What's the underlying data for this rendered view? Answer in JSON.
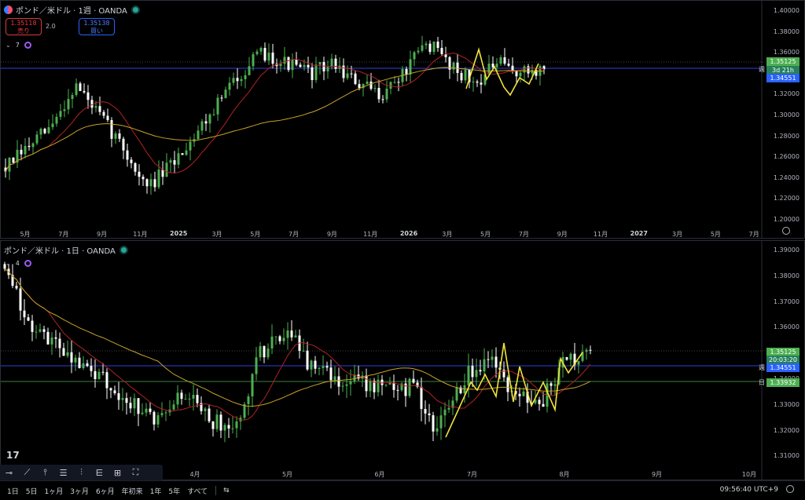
{
  "top_chart": {
    "symbol": "ポンド／米ドル · 1週 · OANDA",
    "sell_price": "1.35118",
    "sell_label": "売り",
    "spread": "2.0",
    "buy_price": "1.35138",
    "buy_label": "買い",
    "indicator_count": "7",
    "y_ticks": [
      "1.40000",
      "1.38000",
      "1.36000",
      "1.34000",
      "1.32000",
      "1.30000",
      "1.28000",
      "1.26000",
      "1.24000",
      "1.22000",
      "1.20000"
    ],
    "x_ticks": [
      "5月",
      "7月",
      "9月",
      "11月",
      "2025",
      "3月",
      "5月",
      "7月",
      "9月",
      "11月",
      "2026",
      "3月",
      "5月",
      "7月",
      "9月",
      "11月",
      "2027",
      "3月",
      "5月",
      "7月"
    ],
    "last_price_tag": "1.35125",
    "countdown_tag": "3d 21h",
    "weekly_level_tag": "1.34551",
    "weekly_level_label": "週",
    "colors": {
      "up": "#26a69a",
      "bull_body": "#4caf50",
      "down": "#ffffff",
      "ma_red": "#b22222",
      "ma_gold": "#c9a227",
      "zigzag": "#f0e23a",
      "level": "#2f3fd9"
    }
  },
  "bottom_chart": {
    "symbol": "ポンド／米ドル · 1日 · OANDA",
    "indicator_count": "4",
    "y_ticks": [
      "1.39000",
      "1.38000",
      "1.37000",
      "1.36000",
      "1.35000",
      "1.34000",
      "1.33000",
      "1.32000",
      "1.31000"
    ],
    "x_ticks": [
      "4月",
      "5月",
      "6月",
      "7月",
      "8月",
      "9月",
      "10月"
    ],
    "last_price_tag": "1.35125",
    "countdown_tag": "20:03:20",
    "weekly_level_tag": "1.34551",
    "weekly_level_label": "週",
    "daily_level_tag": "1.33932",
    "daily_level_label": "日"
  },
  "bottom_bar": {
    "timeframes": [
      "1日",
      "5日",
      "1ヶ月",
      "3ヶ月",
      "6ヶ月",
      "年初来",
      "1年",
      "5年",
      "すべて"
    ],
    "time": "09:56:40 UTC+9"
  },
  "logo_text": "17"
}
